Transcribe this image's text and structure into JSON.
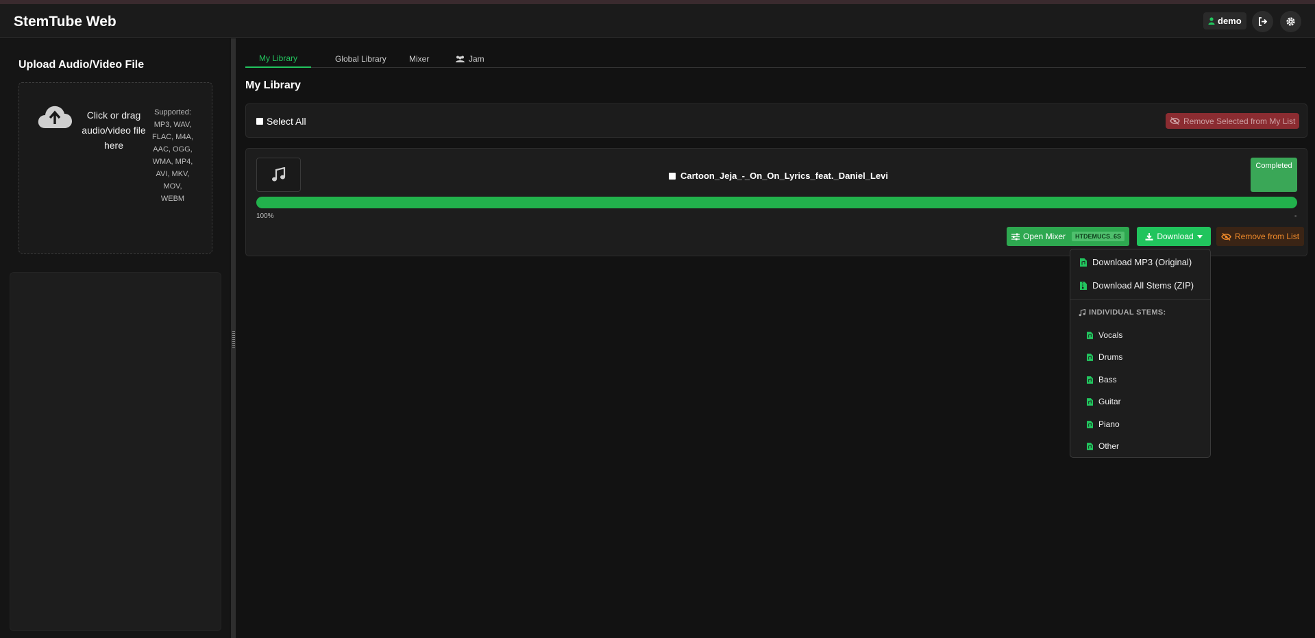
{
  "header": {
    "app_title": "StemTube Web",
    "user_name": "demo",
    "logout_icon": "sign-out-icon",
    "settings_icon": "gear-icon"
  },
  "sidebar": {
    "upload_title": "Upload Audio/Video File",
    "drop_text": "Click or drag audio/video file here",
    "supported_label": "Supported:",
    "supported_formats": "MP3, WAV, FLAC, M4A, AAC, OGG, WMA, MP4, AVI, MKV, MOV, WEBM"
  },
  "tabs": [
    {
      "label": "My Library",
      "active": true
    },
    {
      "label": "Global Library",
      "active": false
    },
    {
      "label": "Mixer",
      "active": false
    },
    {
      "label": "Jam",
      "active": false,
      "icon": "users-icon"
    }
  ],
  "main": {
    "title": "My Library",
    "select_all": "Select All",
    "remove_selected": "Remove Selected from My List",
    "item": {
      "title": "Cartoon_Jeja_-_On_On_Lyrics_feat._Daniel_Levi",
      "status": "Completed",
      "progress": 1.0,
      "progress_label": "100%",
      "time_label": "-",
      "open_mixer": "Open Mixer",
      "model": "HTDEMUCS_6S",
      "download": "Download",
      "remove": "Remove from List"
    }
  },
  "download_menu": {
    "mp3": "Download MP3 (Original)",
    "zip": "Download All Stems (ZIP)",
    "stems_header": "INDIVIDUAL STEMS:",
    "stems": [
      "Vocals",
      "Drums",
      "Bass",
      "Guitar",
      "Piano",
      "Other"
    ]
  },
  "colors": {
    "accent": "#22c55e",
    "danger": "#8b2c31",
    "warning": "#f08a2a"
  }
}
